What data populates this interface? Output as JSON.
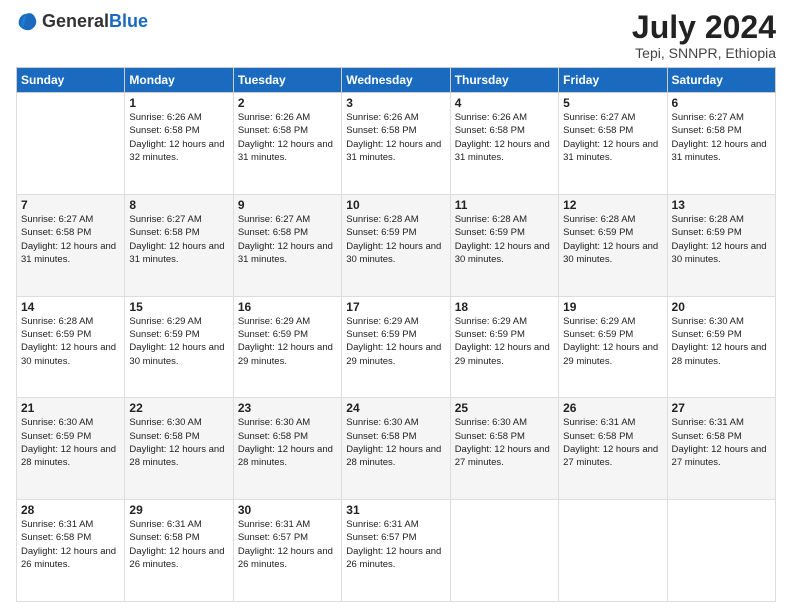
{
  "header": {
    "logo_general": "General",
    "logo_blue": "Blue",
    "month_year": "July 2024",
    "location": "Tepi, SNNPR, Ethiopia"
  },
  "days_of_week": [
    "Sunday",
    "Monday",
    "Tuesday",
    "Wednesday",
    "Thursday",
    "Friday",
    "Saturday"
  ],
  "weeks": [
    [
      {
        "day": "",
        "sunrise": "",
        "sunset": "",
        "daylight": ""
      },
      {
        "day": "1",
        "sunrise": "Sunrise: 6:26 AM",
        "sunset": "Sunset: 6:58 PM",
        "daylight": "Daylight: 12 hours and 32 minutes."
      },
      {
        "day": "2",
        "sunrise": "Sunrise: 6:26 AM",
        "sunset": "Sunset: 6:58 PM",
        "daylight": "Daylight: 12 hours and 31 minutes."
      },
      {
        "day": "3",
        "sunrise": "Sunrise: 6:26 AM",
        "sunset": "Sunset: 6:58 PM",
        "daylight": "Daylight: 12 hours and 31 minutes."
      },
      {
        "day": "4",
        "sunrise": "Sunrise: 6:26 AM",
        "sunset": "Sunset: 6:58 PM",
        "daylight": "Daylight: 12 hours and 31 minutes."
      },
      {
        "day": "5",
        "sunrise": "Sunrise: 6:27 AM",
        "sunset": "Sunset: 6:58 PM",
        "daylight": "Daylight: 12 hours and 31 minutes."
      },
      {
        "day": "6",
        "sunrise": "Sunrise: 6:27 AM",
        "sunset": "Sunset: 6:58 PM",
        "daylight": "Daylight: 12 hours and 31 minutes."
      }
    ],
    [
      {
        "day": "7",
        "sunrise": "Sunrise: 6:27 AM",
        "sunset": "Sunset: 6:58 PM",
        "daylight": "Daylight: 12 hours and 31 minutes."
      },
      {
        "day": "8",
        "sunrise": "Sunrise: 6:27 AM",
        "sunset": "Sunset: 6:58 PM",
        "daylight": "Daylight: 12 hours and 31 minutes."
      },
      {
        "day": "9",
        "sunrise": "Sunrise: 6:27 AM",
        "sunset": "Sunset: 6:58 PM",
        "daylight": "Daylight: 12 hours and 31 minutes."
      },
      {
        "day": "10",
        "sunrise": "Sunrise: 6:28 AM",
        "sunset": "Sunset: 6:59 PM",
        "daylight": "Daylight: 12 hours and 30 minutes."
      },
      {
        "day": "11",
        "sunrise": "Sunrise: 6:28 AM",
        "sunset": "Sunset: 6:59 PM",
        "daylight": "Daylight: 12 hours and 30 minutes."
      },
      {
        "day": "12",
        "sunrise": "Sunrise: 6:28 AM",
        "sunset": "Sunset: 6:59 PM",
        "daylight": "Daylight: 12 hours and 30 minutes."
      },
      {
        "day": "13",
        "sunrise": "Sunrise: 6:28 AM",
        "sunset": "Sunset: 6:59 PM",
        "daylight": "Daylight: 12 hours and 30 minutes."
      }
    ],
    [
      {
        "day": "14",
        "sunrise": "Sunrise: 6:28 AM",
        "sunset": "Sunset: 6:59 PM",
        "daylight": "Daylight: 12 hours and 30 minutes."
      },
      {
        "day": "15",
        "sunrise": "Sunrise: 6:29 AM",
        "sunset": "Sunset: 6:59 PM",
        "daylight": "Daylight: 12 hours and 30 minutes."
      },
      {
        "day": "16",
        "sunrise": "Sunrise: 6:29 AM",
        "sunset": "Sunset: 6:59 PM",
        "daylight": "Daylight: 12 hours and 29 minutes."
      },
      {
        "day": "17",
        "sunrise": "Sunrise: 6:29 AM",
        "sunset": "Sunset: 6:59 PM",
        "daylight": "Daylight: 12 hours and 29 minutes."
      },
      {
        "day": "18",
        "sunrise": "Sunrise: 6:29 AM",
        "sunset": "Sunset: 6:59 PM",
        "daylight": "Daylight: 12 hours and 29 minutes."
      },
      {
        "day": "19",
        "sunrise": "Sunrise: 6:29 AM",
        "sunset": "Sunset: 6:59 PM",
        "daylight": "Daylight: 12 hours and 29 minutes."
      },
      {
        "day": "20",
        "sunrise": "Sunrise: 6:30 AM",
        "sunset": "Sunset: 6:59 PM",
        "daylight": "Daylight: 12 hours and 28 minutes."
      }
    ],
    [
      {
        "day": "21",
        "sunrise": "Sunrise: 6:30 AM",
        "sunset": "Sunset: 6:59 PM",
        "daylight": "Daylight: 12 hours and 28 minutes."
      },
      {
        "day": "22",
        "sunrise": "Sunrise: 6:30 AM",
        "sunset": "Sunset: 6:58 PM",
        "daylight": "Daylight: 12 hours and 28 minutes."
      },
      {
        "day": "23",
        "sunrise": "Sunrise: 6:30 AM",
        "sunset": "Sunset: 6:58 PM",
        "daylight": "Daylight: 12 hours and 28 minutes."
      },
      {
        "day": "24",
        "sunrise": "Sunrise: 6:30 AM",
        "sunset": "Sunset: 6:58 PM",
        "daylight": "Daylight: 12 hours and 28 minutes."
      },
      {
        "day": "25",
        "sunrise": "Sunrise: 6:30 AM",
        "sunset": "Sunset: 6:58 PM",
        "daylight": "Daylight: 12 hours and 27 minutes."
      },
      {
        "day": "26",
        "sunrise": "Sunrise: 6:31 AM",
        "sunset": "Sunset: 6:58 PM",
        "daylight": "Daylight: 12 hours and 27 minutes."
      },
      {
        "day": "27",
        "sunrise": "Sunrise: 6:31 AM",
        "sunset": "Sunset: 6:58 PM",
        "daylight": "Daylight: 12 hours and 27 minutes."
      }
    ],
    [
      {
        "day": "28",
        "sunrise": "Sunrise: 6:31 AM",
        "sunset": "Sunset: 6:58 PM",
        "daylight": "Daylight: 12 hours and 26 minutes."
      },
      {
        "day": "29",
        "sunrise": "Sunrise: 6:31 AM",
        "sunset": "Sunset: 6:58 PM",
        "daylight": "Daylight: 12 hours and 26 minutes."
      },
      {
        "day": "30",
        "sunrise": "Sunrise: 6:31 AM",
        "sunset": "Sunset: 6:57 PM",
        "daylight": "Daylight: 12 hours and 26 minutes."
      },
      {
        "day": "31",
        "sunrise": "Sunrise: 6:31 AM",
        "sunset": "Sunset: 6:57 PM",
        "daylight": "Daylight: 12 hours and 26 minutes."
      },
      {
        "day": "",
        "sunrise": "",
        "sunset": "",
        "daylight": ""
      },
      {
        "day": "",
        "sunrise": "",
        "sunset": "",
        "daylight": ""
      },
      {
        "day": "",
        "sunrise": "",
        "sunset": "",
        "daylight": ""
      }
    ]
  ]
}
